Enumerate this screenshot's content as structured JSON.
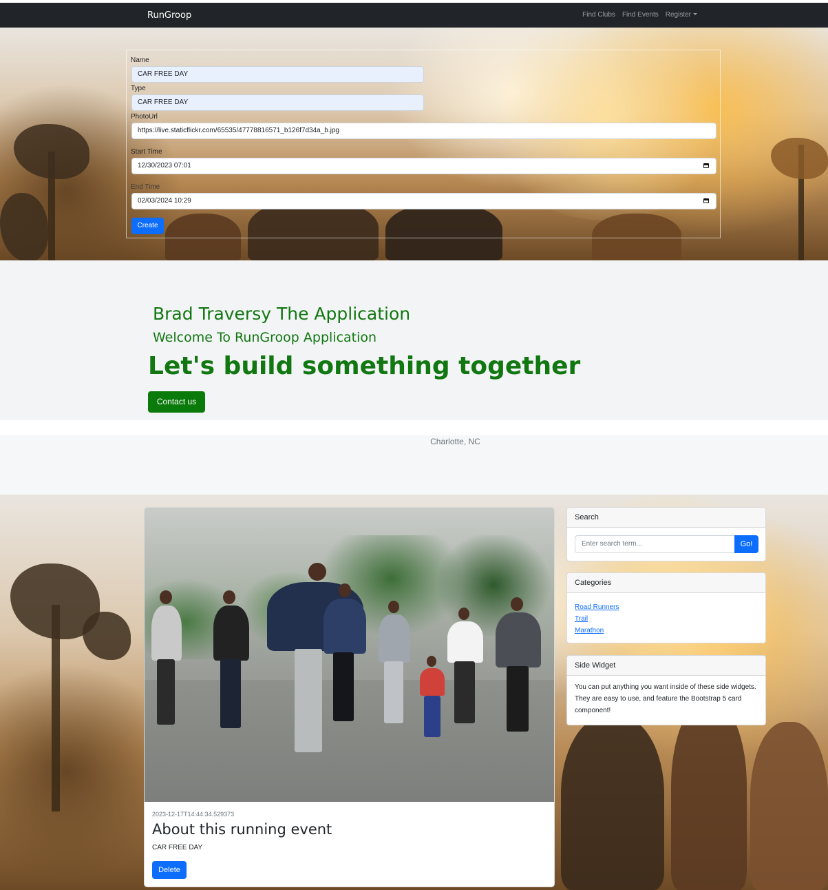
{
  "navbar": {
    "brand": "RunGroop",
    "links": [
      "Find Clubs",
      "Find Events",
      "Register"
    ]
  },
  "form": {
    "name_label": "Name",
    "name_value": "CAR FREE DAY",
    "type_label": "Type",
    "type_value": "CAR FREE DAY",
    "photo_label": "PhotoUrl",
    "photo_value": "https://live.staticflickr.com/65535/47778816571_b126f7d34a_b.jpg",
    "start_label": "Start Time",
    "start_value": "12/30/2023 07:01",
    "end_label": "End Time",
    "end_value": "02/03/2024 10:29",
    "submit_label": "Create"
  },
  "jumbotron": {
    "heading_small": "Brad Traversy The Application",
    "heading_medium": "Welcome To RunGroop Application",
    "heading_large": "Let's build something together",
    "button_label": "Contact us"
  },
  "location": "Charlotte, NC",
  "event": {
    "timestamp": "2023-12-17T14:44:34.529373",
    "title": "About this running event",
    "name": "CAR FREE DAY",
    "delete_label": "Delete"
  },
  "sidebar": {
    "search": {
      "header": "Search",
      "placeholder": "Enter search term...",
      "button": "Go!"
    },
    "categories": {
      "header": "Categories",
      "items": [
        "Road Runners",
        "Trail",
        "Marathon"
      ]
    },
    "side_widget": {
      "header": "Side Widget",
      "text": "You can put anything you want inside of these side widgets. They are easy to use, and feature the Bootstrap 5 card component!"
    }
  }
}
